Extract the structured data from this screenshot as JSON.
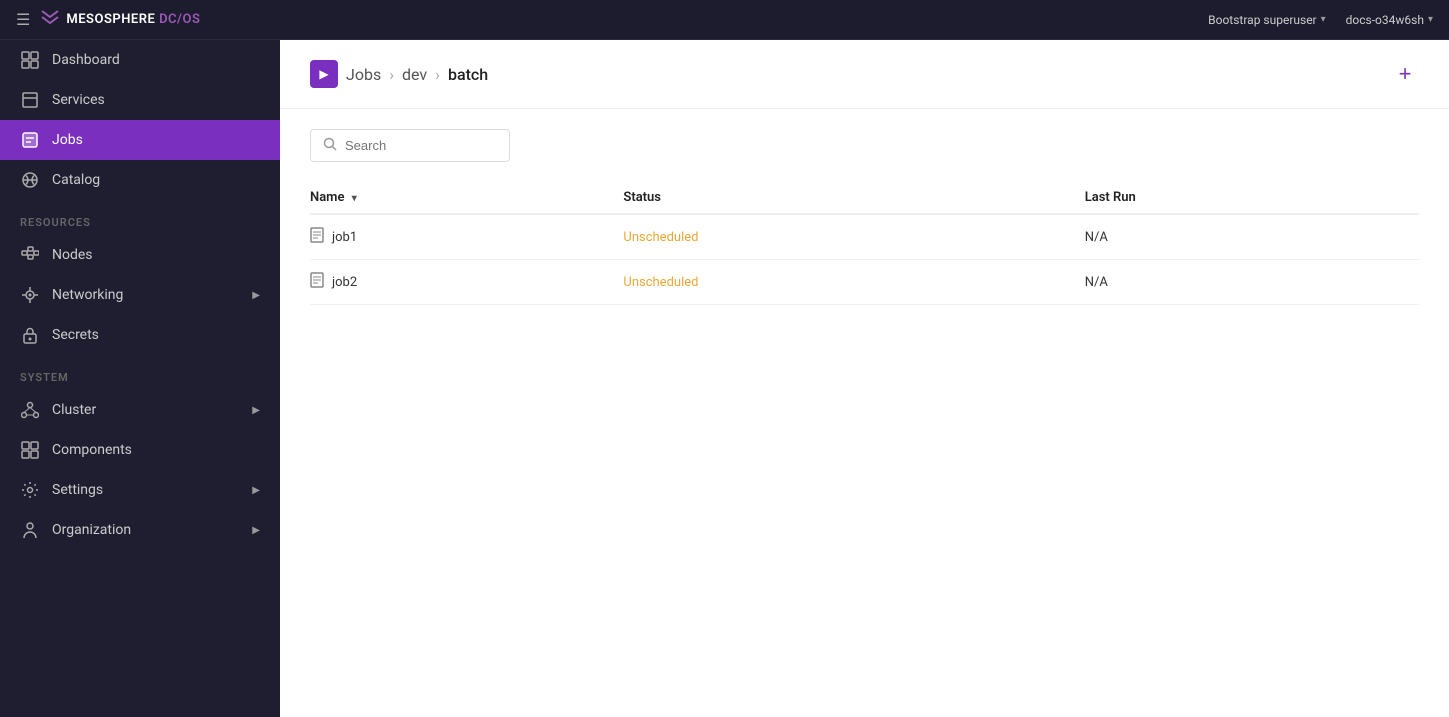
{
  "navbar": {
    "hamburger_label": "☰",
    "logo_prefix": "MESOSPHERE ",
    "logo_dc": "DC",
    "logo_slash": "/",
    "logo_os": "OS",
    "user": "Bootstrap superuser",
    "host": "docs-o34w6sh"
  },
  "sidebar": {
    "nav_items": [
      {
        "id": "dashboard",
        "label": "Dashboard",
        "icon": "dashboard",
        "active": false,
        "arrow": false
      },
      {
        "id": "services",
        "label": "Services",
        "icon": "services",
        "active": false,
        "arrow": false
      },
      {
        "id": "jobs",
        "label": "Jobs",
        "icon": "jobs",
        "active": true,
        "arrow": false
      },
      {
        "id": "catalog",
        "label": "Catalog",
        "icon": "catalog",
        "active": false,
        "arrow": false
      }
    ],
    "resources_label": "Resources",
    "resources_items": [
      {
        "id": "nodes",
        "label": "Nodes",
        "icon": "nodes",
        "active": false,
        "arrow": false
      },
      {
        "id": "networking",
        "label": "Networking",
        "icon": "networking",
        "active": false,
        "arrow": true
      },
      {
        "id": "secrets",
        "label": "Secrets",
        "icon": "secrets",
        "active": false,
        "arrow": false
      }
    ],
    "system_label": "System",
    "system_items": [
      {
        "id": "cluster",
        "label": "Cluster",
        "icon": "cluster",
        "active": false,
        "arrow": true
      },
      {
        "id": "components",
        "label": "Components",
        "icon": "components",
        "active": false,
        "arrow": false
      },
      {
        "id": "settings",
        "label": "Settings",
        "icon": "settings",
        "active": false,
        "arrow": true
      },
      {
        "id": "organization",
        "label": "Organization",
        "icon": "organization",
        "active": false,
        "arrow": true
      }
    ]
  },
  "breadcrumb": {
    "icon": "▶",
    "parts": [
      "Jobs",
      "dev",
      "batch"
    ],
    "separators": [
      ">",
      ">"
    ]
  },
  "table": {
    "search_placeholder": "Search",
    "columns": [
      "Name",
      "Status",
      "Last Run"
    ],
    "rows": [
      {
        "name": "job1",
        "status": "Unscheduled",
        "last_run": "N/A"
      },
      {
        "name": "job2",
        "status": "Unscheduled",
        "last_run": "N/A"
      }
    ]
  },
  "add_button_label": "+"
}
